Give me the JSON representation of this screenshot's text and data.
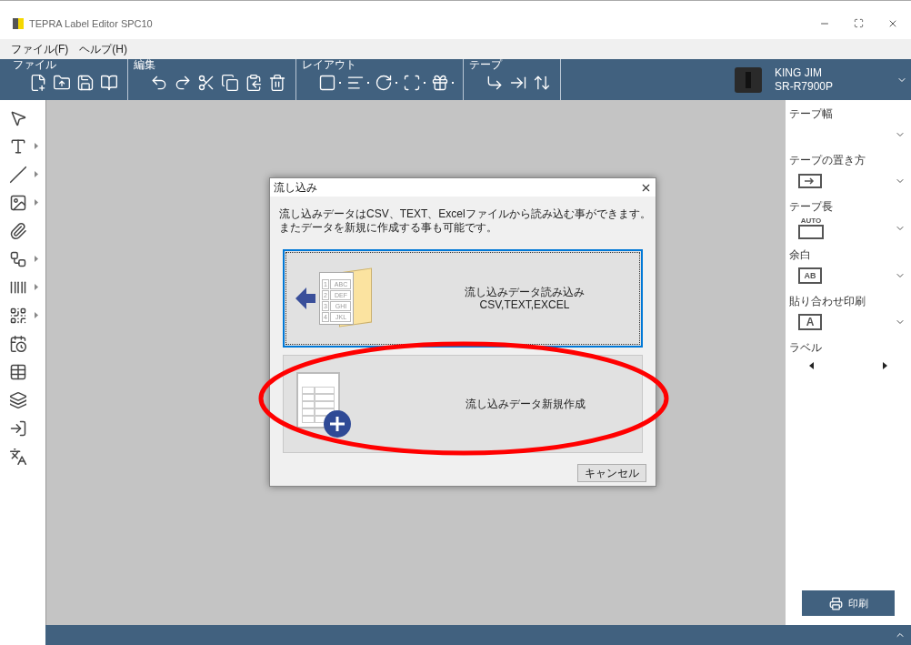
{
  "window": {
    "title": "TEPRA Label Editor SPC10"
  },
  "menu": [
    "ファイル(F)",
    "ヘルプ(H)"
  ],
  "ribbon": {
    "groups": [
      {
        "label": "ファイル",
        "tools": [
          {
            "kind": "new",
            "dropdown": false
          },
          {
            "kind": "open",
            "dropdown": false
          },
          {
            "kind": "save",
            "dropdown": false
          },
          {
            "kind": "book",
            "dropdown": false
          }
        ]
      },
      {
        "label": "編集",
        "tools": [
          {
            "kind": "undo",
            "dropdown": false
          },
          {
            "kind": "redo",
            "dropdown": false
          },
          {
            "kind": "cut",
            "dropdown": false
          },
          {
            "kind": "copy",
            "dropdown": false
          },
          {
            "kind": "paste",
            "dropdown": false
          },
          {
            "kind": "delete",
            "dropdown": false
          }
        ]
      },
      {
        "label": "レイアウト",
        "tools": [
          {
            "kind": "frame",
            "dropdown": true
          },
          {
            "kind": "align",
            "dropdown": true
          },
          {
            "kind": "rotate",
            "dropdown": true
          },
          {
            "kind": "fit",
            "dropdown": true
          },
          {
            "kind": "decor",
            "dropdown": true
          }
        ]
      },
      {
        "label": "テープ",
        "tools": [
          {
            "kind": "feed",
            "dropdown": false
          },
          {
            "kind": "cut-tape",
            "dropdown": false
          },
          {
            "kind": "length",
            "dropdown": false
          }
        ]
      }
    ],
    "device": {
      "maker": "KING JIM",
      "model": "SR-R7900P"
    }
  },
  "tools": [
    {
      "kind": "pointer",
      "submenu": false
    },
    {
      "kind": "text",
      "submenu": true
    },
    {
      "kind": "line",
      "submenu": true
    },
    {
      "kind": "image",
      "submenu": true
    },
    {
      "kind": "clip",
      "submenu": false
    },
    {
      "kind": "shape",
      "submenu": true
    },
    {
      "kind": "barcode",
      "submenu": true
    },
    {
      "kind": "qr",
      "submenu": true
    },
    {
      "kind": "date",
      "submenu": false
    },
    {
      "kind": "table",
      "submenu": false
    },
    {
      "kind": "serial",
      "submenu": false
    },
    {
      "kind": "import",
      "submenu": false
    },
    {
      "kind": "translate",
      "submenu": false
    }
  ],
  "panel": {
    "sections": [
      {
        "label": "テープ幅",
        "kind": "width"
      },
      {
        "label": "テープの置き方",
        "kind": "orient"
      },
      {
        "label": "テープ長",
        "kind": "length",
        "icon_text": "AUTO"
      },
      {
        "label": "余白",
        "kind": "margin",
        "icon_text": "AB"
      },
      {
        "label": "貼り合わせ印刷",
        "kind": "join",
        "icon_text": "A"
      },
      {
        "label": "ラベル",
        "kind": "stepper"
      }
    ],
    "print_button": "印刷"
  },
  "dialog": {
    "title": "流し込み",
    "message": [
      "流し込みデータはCSV、TEXT、Excelファイルから読み込む事ができます。",
      "またデータを新規に作成する事も可能です。"
    ],
    "options": [
      {
        "kind": "import",
        "focused": true,
        "title": "流し込みデータ読み込み",
        "subtitle": "CSV,TEXT,EXCEL",
        "rows": [
          {
            "n": "1",
            "text": "ABC"
          },
          {
            "n": "2",
            "text": "DEF"
          },
          {
            "n": "3",
            "text": "GHI"
          },
          {
            "n": "4",
            "text": "JKL"
          }
        ]
      },
      {
        "kind": "new",
        "focused": false,
        "title": "流し込みデータ新規作成"
      }
    ],
    "cancel": "キャンセル"
  },
  "annotation": {
    "kind": "ellipse",
    "color": "#ff0000"
  }
}
